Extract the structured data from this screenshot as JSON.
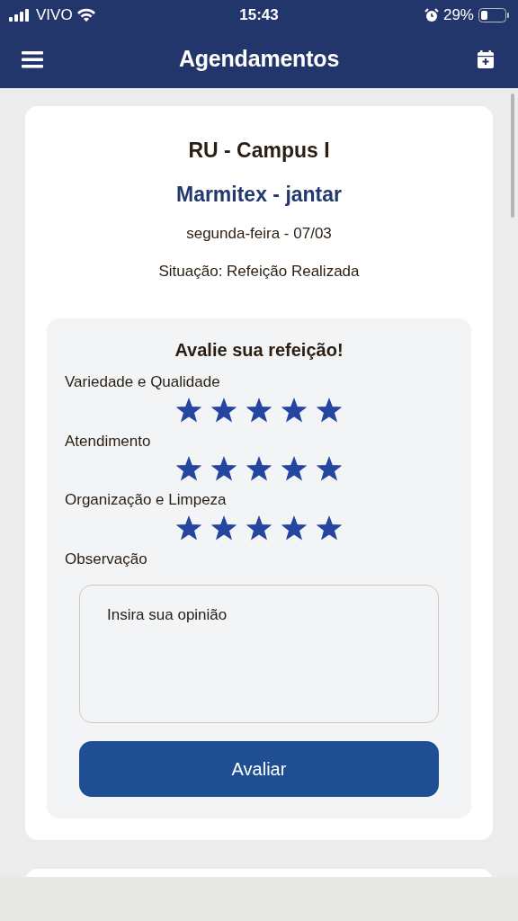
{
  "status_bar": {
    "carrier": "VIVO",
    "time": "15:43",
    "battery": "29%"
  },
  "header": {
    "title": "Agendamentos"
  },
  "card": {
    "place": "RU - Campus I",
    "meal": "Marmitex - jantar",
    "date": "segunda-feira - 07/03",
    "status": "Situação: Refeição Realizada"
  },
  "rating": {
    "title": "Avalie sua refeição!",
    "criteria": [
      {
        "label": "Variedade e Qualidade",
        "stars": 5
      },
      {
        "label": "Atendimento",
        "stars": 5
      },
      {
        "label": "Organização e Limpeza",
        "stars": 5
      }
    ],
    "note_label": "Observação",
    "note": {
      "placeholder": "Insira sua opinião"
    },
    "button": "Avaliar"
  }
}
